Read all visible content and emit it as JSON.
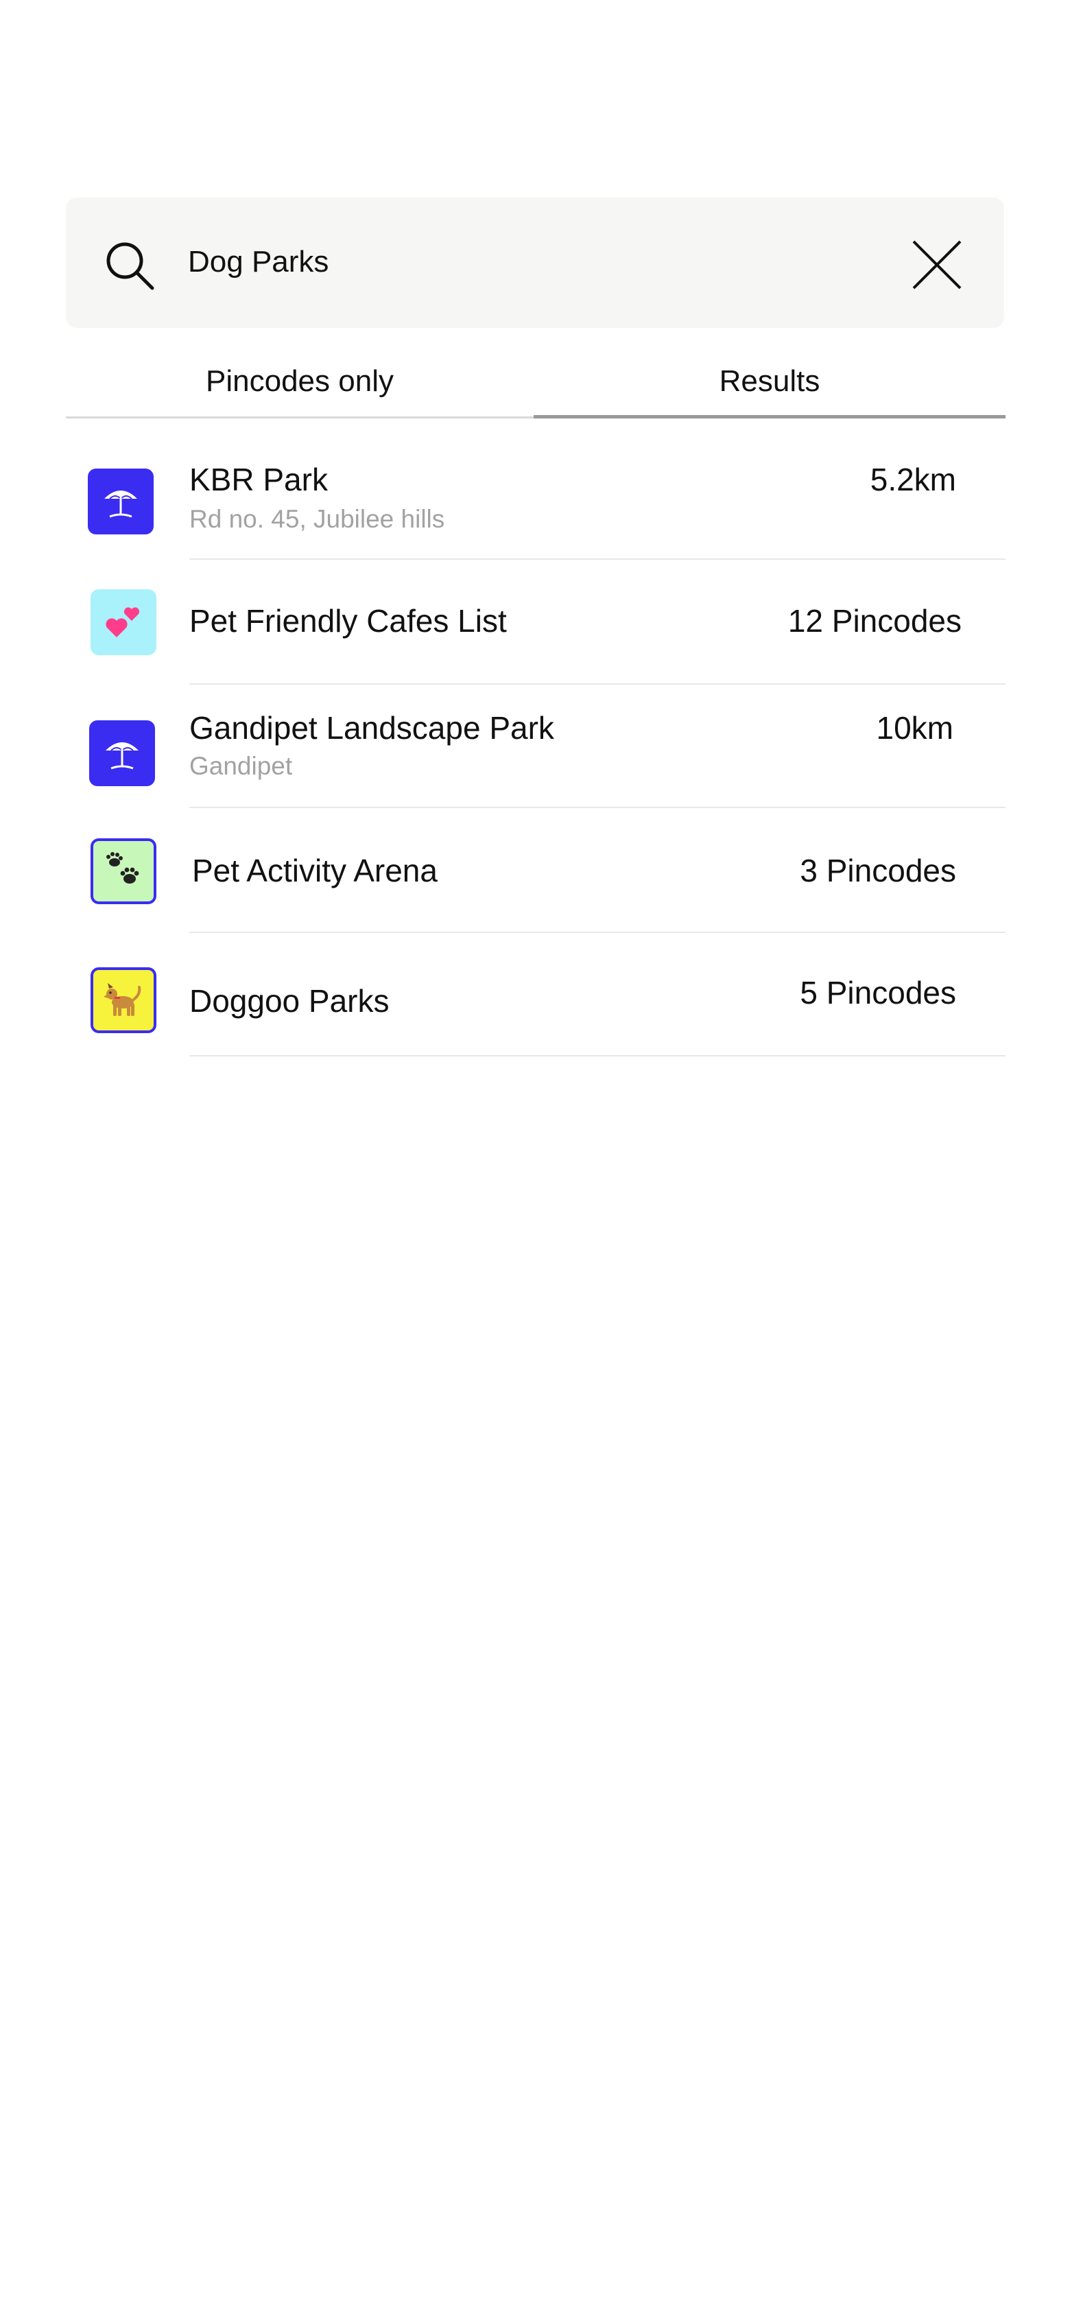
{
  "search": {
    "query": "Dog Parks",
    "icon": "search-icon",
    "clear_icon": "close-icon"
  },
  "tabs": [
    {
      "label": "Pincodes only",
      "selected": false
    },
    {
      "label": "Results",
      "selected": true
    }
  ],
  "results": [
    {
      "title": "KBR Park",
      "subtitle": "Rd no. 45, Jubilee hills",
      "meta": "5.2km",
      "icon": "beach-umbrella-icon",
      "tile_color": "#3b2cf2"
    },
    {
      "title": "Pet Friendly Cafes List",
      "subtitle": "",
      "meta": "12 Pincodes",
      "icon": "two-hearts-icon",
      "tile_color": "#a9f1fb"
    },
    {
      "title": "Gandipet Landscape Park",
      "subtitle": "Gandipet",
      "meta": "10km",
      "icon": "beach-umbrella-icon",
      "tile_color": "#3b2cf2"
    },
    {
      "title": "Pet Activity Arena",
      "subtitle": "",
      "meta": "3 Pincodes",
      "icon": "paw-prints-icon",
      "tile_color": "#c7f7b9"
    },
    {
      "title": "Doggoo Parks",
      "subtitle": "",
      "meta": "5 Pincodes",
      "icon": "dog-icon",
      "tile_color": "#f7f23c"
    }
  ],
  "colors": {
    "accent": "#3b2cf2",
    "search_bg": "#f6f6f4",
    "subtitle": "#a2a2a2",
    "divider": "#e8e8e8",
    "active_tab_underline": "#9a9a9a"
  }
}
